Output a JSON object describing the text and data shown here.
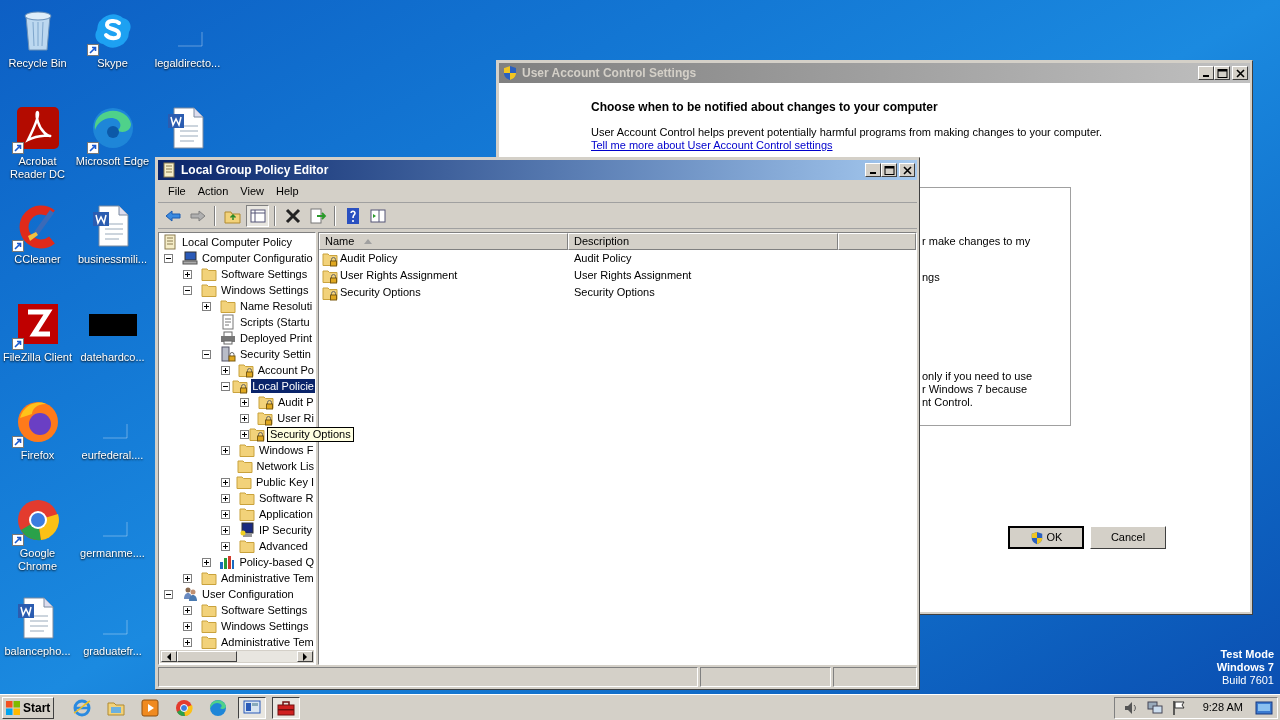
{
  "desktop": {
    "icon_columns": [
      [
        {
          "label": "Recycle Bin",
          "kind": "recycle"
        },
        {
          "label": "Acrobat Reader DC",
          "kind": "acrobat",
          "shortcut": true
        },
        {
          "label": "CCleaner",
          "kind": "ccleaner",
          "shortcut": true
        },
        {
          "label": "FileZilla Client",
          "kind": "filezilla",
          "shortcut": true
        },
        {
          "label": "Firefox",
          "kind": "firefox",
          "shortcut": true
        },
        {
          "label": "Google Chrome",
          "kind": "chrome",
          "shortcut": true
        },
        {
          "label": "balancepho...",
          "kind": "word"
        }
      ],
      [
        {
          "label": "Skype",
          "kind": "skype",
          "shortcut": true
        },
        {
          "label": "Microsoft Edge",
          "kind": "edge",
          "shortcut": true
        },
        {
          "label": "businessmili...",
          "kind": "word"
        },
        {
          "label": "datehardco...",
          "kind": "black"
        },
        {
          "label": "eurfederal....",
          "kind": "blank"
        },
        {
          "label": "germanme....",
          "kind": "blank"
        },
        {
          "label": "graduatefr...",
          "kind": "blank"
        }
      ],
      [
        {
          "label": "legaldirecto...",
          "kind": "blank"
        },
        {
          "kind": "word"
        }
      ]
    ],
    "os_notice": [
      "Test Mode",
      "Windows 7",
      "Build 7601"
    ]
  },
  "uac_window": {
    "title": "User Account Control Settings",
    "active": false,
    "heading": "Choose when to be notified about changes to your computer",
    "intro": "User Account Control helps prevent potentially harmful programs from making changes to your computer.",
    "link": "Tell me more about User Account Control settings",
    "panel_groups": [
      [
        "r make changes to my"
      ],
      [
        "ngs"
      ],
      [
        "only if you need to use",
        "r Windows 7 because",
        "nt Control."
      ]
    ],
    "buttons": [
      {
        "label": "OK",
        "shield": true,
        "default": true
      },
      {
        "label": "Cancel",
        "shield": false,
        "default": false
      }
    ]
  },
  "gpe_window": {
    "title": "Local Group Policy Editor",
    "active": true,
    "menu": [
      "File",
      "Action",
      "View",
      "Help"
    ],
    "tree": [
      {
        "label": "Local Computer Policy",
        "kind": "policy",
        "selected": false,
        "children": [
          {
            "label": "Computer Configuratio",
            "kind": "computer",
            "expanded": true,
            "selected": false,
            "children": [
              {
                "label": "Software Settings",
                "kind": "folder",
                "expanded": false,
                "selected": false
              },
              {
                "label": "Windows Settings",
                "kind": "folder",
                "expanded": true,
                "selected": false,
                "children": [
                  {
                    "label": "Name Resoluti",
                    "kind": "folder",
                    "expanded": false,
                    "selected": false
                  },
                  {
                    "label": "Scripts (Startu",
                    "kind": "script",
                    "selected": false
                  },
                  {
                    "label": "Deployed Print",
                    "kind": "printer",
                    "selected": false
                  },
                  {
                    "label": "Security Settin",
                    "kind": "security",
                    "expanded": true,
                    "selected": false,
                    "children": [
                      {
                        "label": "Account Po",
                        "kind": "lockfolder",
                        "expanded": false,
                        "selected": false
                      },
                      {
                        "label": "Local Policie",
                        "kind": "lockfolder",
                        "expanded": true,
                        "selected": true,
                        "children": [
                          {
                            "label": "Audit P",
                            "kind": "lockfolder",
                            "expanded": false,
                            "selected": false
                          },
                          {
                            "label": "User Ri",
                            "kind": "lockfolder",
                            "expanded": false,
                            "selected": false
                          },
                          {
                            "tooltip": "Security Options",
                            "kind": "lockfolder",
                            "expanded": false
                          }
                        ]
                      },
                      {
                        "label": "Windows F",
                        "kind": "folder",
                        "expanded": false,
                        "selected": false
                      },
                      {
                        "label": "Network Lis",
                        "kind": "folder",
                        "selected": false
                      },
                      {
                        "label": "Public Key I",
                        "kind": "folder",
                        "expanded": false,
                        "selected": false
                      },
                      {
                        "label": "Software R",
                        "kind": "folder",
                        "expanded": false,
                        "selected": false
                      },
                      {
                        "label": "Application",
                        "kind": "folder",
                        "expanded": false,
                        "selected": false
                      },
                      {
                        "label": "IP Security",
                        "kind": "ipsec",
                        "expanded": false,
                        "selected": false
                      },
                      {
                        "label": "Advanced",
                        "kind": "folder",
                        "expanded": false,
                        "selected": false
                      }
                    ]
                  },
                  {
                    "label": "Policy-based Q",
                    "kind": "chart",
                    "expanded": false,
                    "selected": false
                  }
                ]
              },
              {
                "label": "Administrative Tem",
                "kind": "folder",
                "expanded": false,
                "selected": false
              }
            ]
          },
          {
            "label": "User Configuration",
            "kind": "user",
            "expanded": true,
            "selected": false,
            "children": [
              {
                "label": "Software Settings",
                "kind": "folder",
                "expanded": false,
                "selected": false
              },
              {
                "label": "Windows Settings",
                "kind": "folder",
                "expanded": false,
                "selected": false
              },
              {
                "label": "Administrative Tem",
                "kind": "folder",
                "expanded": false,
                "selected": false
              }
            ]
          }
        ]
      }
    ],
    "columns": [
      {
        "label": "Name",
        "sorted": true
      },
      {
        "label": "Description",
        "sorted": false
      }
    ],
    "rows": [
      {
        "name": "Audit Policy",
        "description": "Audit Policy"
      },
      {
        "name": "User Rights Assignment",
        "description": "User Rights Assignment"
      },
      {
        "name": "Security Options",
        "description": "Security Options"
      }
    ]
  },
  "taskbar": {
    "start": "Start",
    "items": [
      {
        "kind": "ie",
        "pressed": false
      },
      {
        "kind": "explorer",
        "pressed": false
      },
      {
        "kind": "media",
        "pressed": false
      },
      {
        "kind": "chrome",
        "pressed": false
      },
      {
        "kind": "edge",
        "pressed": false
      },
      {
        "kind": "gpe",
        "pressed": true
      },
      {
        "kind": "toolbox",
        "pressed": true
      }
    ],
    "clock": "9:28 AM"
  }
}
